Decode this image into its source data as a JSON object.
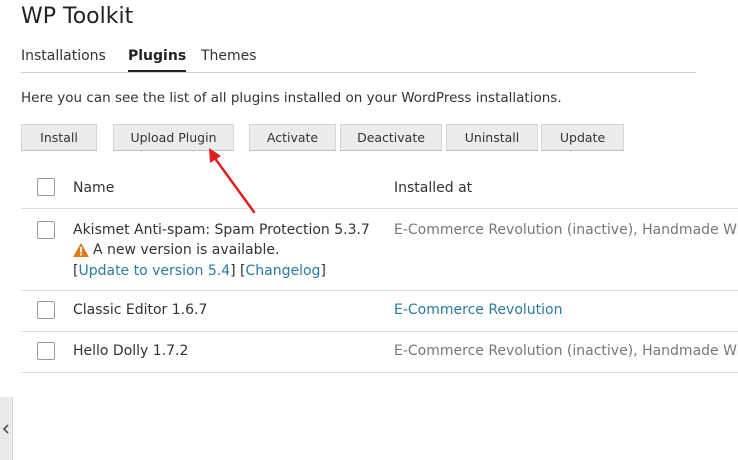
{
  "app": {
    "title": "WP Toolkit"
  },
  "tabs": [
    {
      "label": "Installations",
      "active": false
    },
    {
      "label": "Plugins",
      "active": true
    },
    {
      "label": "Themes",
      "active": false
    }
  ],
  "intro_text": "Here you can see the list of all plugins installed on your WordPress installations.",
  "toolbar": {
    "install": "Install",
    "upload_plugin": "Upload Plugin",
    "activate": "Activate",
    "deactivate": "Deactivate",
    "uninstall": "Uninstall",
    "update": "Update"
  },
  "table": {
    "columns": [
      "Name",
      "Installed at"
    ],
    "rows": [
      {
        "name": "Akismet Anti-spam: Spam Protection 5.3.7",
        "installed_at": "E-Commerce Revolution (inactive), Handmade With Lo",
        "notice": "A new version is available.",
        "bracket_open_1": "[",
        "update_link": "Update to version 5.4",
        "bracket_mid": "] [",
        "changelog_link": "Changelog",
        "bracket_close": "]"
      },
      {
        "name": "Classic Editor 1.6.7",
        "installed_at": "E-Commerce Revolution"
      },
      {
        "name": "Hello Dolly 1.7.2",
        "installed_at": "E-Commerce Revolution (inactive), Handmade With Lo"
      }
    ]
  },
  "icons": {
    "warning": "warning-triangle-icon",
    "collapse": "chevron-left-icon",
    "annotation": "red-arrow"
  },
  "colors": {
    "link": "#2a7aa1",
    "warning": "#e07b1a",
    "annotation_arrow": "#e02020"
  }
}
